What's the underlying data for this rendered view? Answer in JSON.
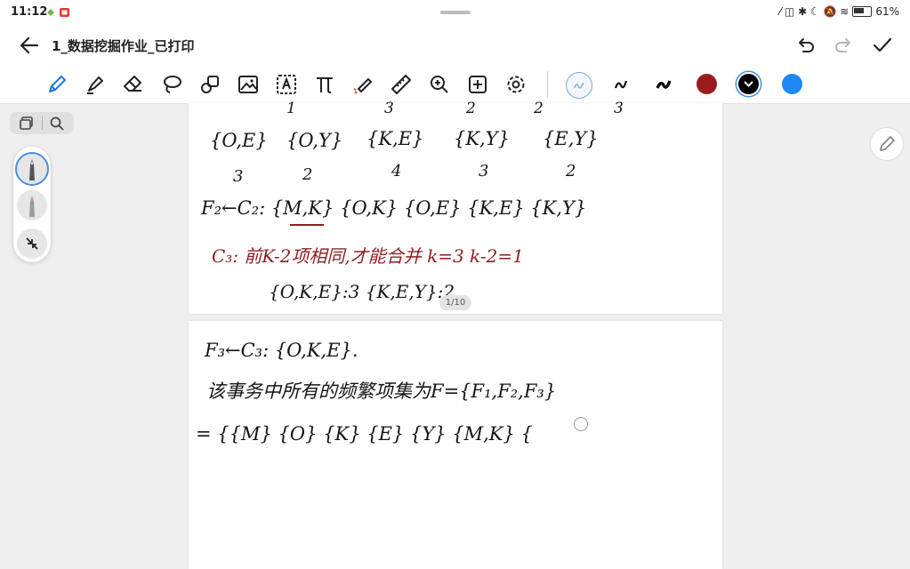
{
  "status": {
    "time": "11:12",
    "battery": "61%"
  },
  "titlebar": {
    "title": "1_数据挖掘作业_已打印"
  },
  "toolbar": {
    "tools": [
      "pen-icon",
      "highlighter-icon",
      "eraser-icon",
      "lasso-icon",
      "shapes-icon",
      "image-icon",
      "text-box-icon",
      "formula-icon",
      "laser-pointer-icon",
      "ruler-icon",
      "zoom-in-icon",
      "add-icon",
      "settings-icon"
    ],
    "colors": [
      "#9b1c1c",
      "#000000",
      "#1e88f5"
    ]
  },
  "page_indicator": "1/10",
  "notes": {
    "counts_top": [
      "1",
      "3",
      "2",
      "2",
      "3"
    ],
    "itemsets_row": [
      "{O,E}",
      "{O,Y}",
      "{K,E}",
      "{K,Y}",
      "{E,Y}"
    ],
    "counts_row": [
      "3",
      "2",
      "4",
      "3",
      "2"
    ],
    "f2_line": "F₂←C₂: {M,K}  {O,K}  {O,E}  {K,E}  {K,Y}",
    "c3_rule": "C₃: 前K-2项相同,才能合并    k=3   k-2=1",
    "c3_sets": "{O,K,E}:3      {K,E,Y}:2",
    "f3_line": "F₃←C₃: {O,K,E}.",
    "conclusion": "该事务中所有的频繁项集为F={F₁,F₂,F₃}",
    "result_line": "= {{M} {O} {K} {E} {Y} {M,K} {"
  }
}
